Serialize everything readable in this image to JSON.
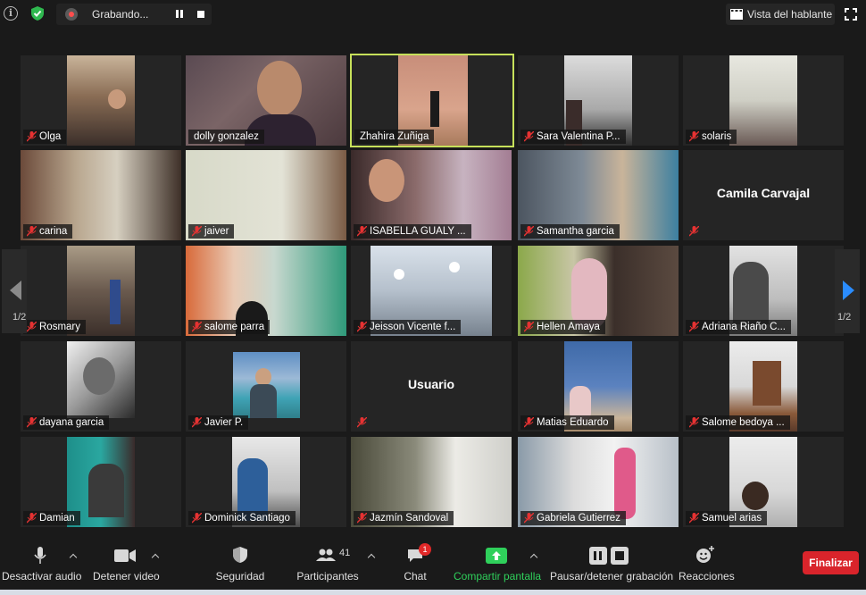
{
  "topbar": {
    "recording_label": "Grabando...",
    "speaker_view_label": "Vista del hablante"
  },
  "participants": [
    {
      "name": "Olga"
    },
    {
      "name": "dolly gonzalez"
    },
    {
      "name": "Zhahira Zuñiga"
    },
    {
      "name": "Sara Valentina P..."
    },
    {
      "name": "solaris"
    },
    {
      "name": "carina"
    },
    {
      "name": "jaiver"
    },
    {
      "name": "ISABELLA GUALY ..."
    },
    {
      "name": "Samantha garcia"
    },
    {
      "name": "",
      "display_name": "Camila Carvajal"
    },
    {
      "name": "Rosmary"
    },
    {
      "name": "salome parra"
    },
    {
      "name": "Jeisson Vicente f..."
    },
    {
      "name": "Hellen Amaya"
    },
    {
      "name": "Adriana Riaño C..."
    },
    {
      "name": "dayana garcia"
    },
    {
      "name": "Javier P."
    },
    {
      "name": "",
      "display_name": "Usuario"
    },
    {
      "name": "Matias Eduardo"
    },
    {
      "name": "Salome bedoya ..."
    },
    {
      "name": "Damian"
    },
    {
      "name": "Dominick Santiago"
    },
    {
      "name": "Jazmín Sandoval"
    },
    {
      "name": "Gabriela Gutierrez"
    },
    {
      "name": "Samuel arias"
    }
  ],
  "pagination": {
    "left": "1/2",
    "right": "1/2"
  },
  "toolbar": {
    "mute_label": "Desactivar audio",
    "video_label": "Detener video",
    "security_label": "Seguridad",
    "participants_label": "Participantes",
    "participants_count": "41",
    "chat_label": "Chat",
    "chat_badge": "1",
    "share_label": "Compartir pantalla",
    "recording_label": "Pausar/detener grabación",
    "reactions_label": "Reacciones",
    "end_label": "Finalizar"
  },
  "colors": {
    "active_speaker": "#c6e05a",
    "share_green": "#2fd05b",
    "end_red": "#d9242b",
    "nav_blue": "#2a8cff"
  }
}
